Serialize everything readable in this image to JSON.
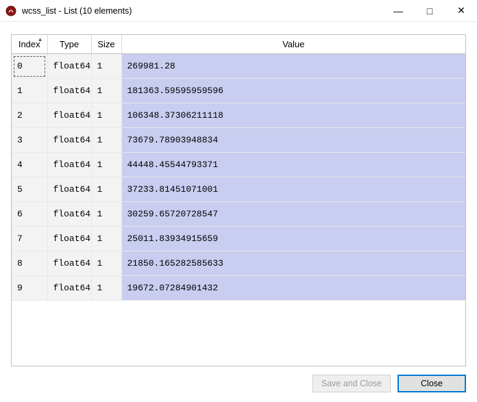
{
  "window": {
    "title": "wcss_list - List (10 elements)",
    "app_icon_name": "spyder-icon"
  },
  "window_controls": {
    "minimize": "—",
    "maximize": "□",
    "close": "✕"
  },
  "headers": {
    "index": "Index",
    "type": "Type",
    "size": "Size",
    "value": "Value",
    "sort_glyph": "▲"
  },
  "rows": [
    {
      "index": "0",
      "type": "float64",
      "size": "1",
      "value": "269981.28"
    },
    {
      "index": "1",
      "type": "float64",
      "size": "1",
      "value": "181363.59595959596"
    },
    {
      "index": "2",
      "type": "float64",
      "size": "1",
      "value": "106348.37306211118"
    },
    {
      "index": "3",
      "type": "float64",
      "size": "1",
      "value": "73679.78903948834"
    },
    {
      "index": "4",
      "type": "float64",
      "size": "1",
      "value": "44448.45544793371"
    },
    {
      "index": "5",
      "type": "float64",
      "size": "1",
      "value": "37233.81451071001"
    },
    {
      "index": "6",
      "type": "float64",
      "size": "1",
      "value": "30259.65720728547"
    },
    {
      "index": "7",
      "type": "float64",
      "size": "1",
      "value": "25011.83934915659"
    },
    {
      "index": "8",
      "type": "float64",
      "size": "1",
      "value": "21850.165282585633"
    },
    {
      "index": "9",
      "type": "float64",
      "size": "1",
      "value": "19672.07284901432"
    }
  ],
  "selected_row_index": 0,
  "buttons": {
    "save_and_close": "Save and Close",
    "close": "Close",
    "save_enabled": false
  }
}
